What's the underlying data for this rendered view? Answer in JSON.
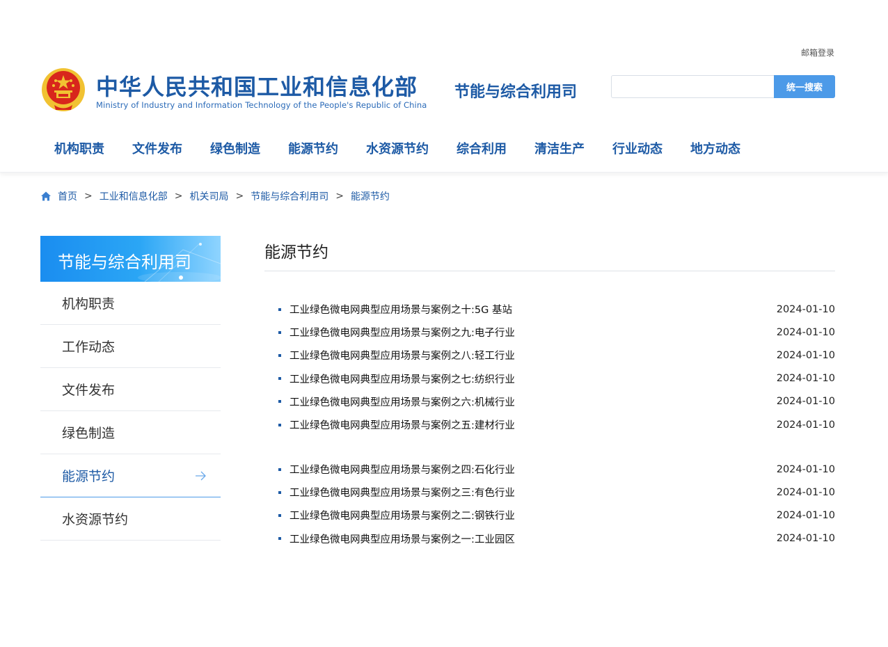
{
  "header": {
    "mail_login": "邮箱登录",
    "ministry_cn": "中华人民共和国工业和信息化部",
    "ministry_en": "Ministry of Industry and Information Technology of the People's Republic of China",
    "department": "节能与综合利用司",
    "search": {
      "placeholder": "",
      "button_label": "统一搜索"
    }
  },
  "nav": {
    "items": [
      {
        "label": "机构职责"
      },
      {
        "label": "文件发布"
      },
      {
        "label": "绿色制造"
      },
      {
        "label": "能源节约"
      },
      {
        "label": "水资源节约"
      },
      {
        "label": "综合利用"
      },
      {
        "label": "清洁生产"
      },
      {
        "label": "行业动态"
      },
      {
        "label": "地方动态"
      }
    ]
  },
  "breadcrumb": {
    "separator": ">",
    "items": [
      "首页",
      "工业和信息化部",
      "机关司局",
      "节能与综合利用司",
      "能源节约"
    ]
  },
  "sidebar": {
    "title": "节能与综合利用司",
    "items": [
      {
        "label": "机构职责",
        "active": false
      },
      {
        "label": "工作动态",
        "active": false
      },
      {
        "label": "文件发布",
        "active": false
      },
      {
        "label": "绿色制造",
        "active": false
      },
      {
        "label": "能源节约",
        "active": true
      },
      {
        "label": "水资源节约",
        "active": false
      }
    ]
  },
  "main": {
    "title": "能源节约",
    "groups": [
      [
        {
          "title": "工业绿色微电网典型应用场景与案例之十:5G 基站",
          "date": "2024-01-10"
        },
        {
          "title": "工业绿色微电网典型应用场景与案例之九:电子行业",
          "date": "2024-01-10"
        },
        {
          "title": "工业绿色微电网典型应用场景与案例之八:轻工行业",
          "date": "2024-01-10"
        },
        {
          "title": "工业绿色微电网典型应用场景与案例之七:纺织行业",
          "date": "2024-01-10"
        },
        {
          "title": "工业绿色微电网典型应用场景与案例之六:机械行业",
          "date": "2024-01-10"
        },
        {
          "title": "工业绿色微电网典型应用场景与案例之五:建材行业",
          "date": "2024-01-10"
        }
      ],
      [
        {
          "title": "工业绿色微电网典型应用场景与案例之四:石化行业",
          "date": "2024-01-10"
        },
        {
          "title": "工业绿色微电网典型应用场景与案例之三:有色行业",
          "date": "2024-01-10"
        },
        {
          "title": "工业绿色微电网典型应用场景与案例之二:钢铁行业",
          "date": "2024-01-10"
        },
        {
          "title": "工业绿色微电网典型应用场景与案例之一:工业园区",
          "date": "2024-01-10"
        }
      ]
    ]
  },
  "colors": {
    "brand_blue": "#1d5aa5",
    "accent_blue": "#4c9ae8",
    "emblem_red": "#d8261c",
    "emblem_gold": "#f1c232"
  },
  "icons": [
    "national-emblem",
    "home-icon",
    "arrow-right-icon"
  ]
}
